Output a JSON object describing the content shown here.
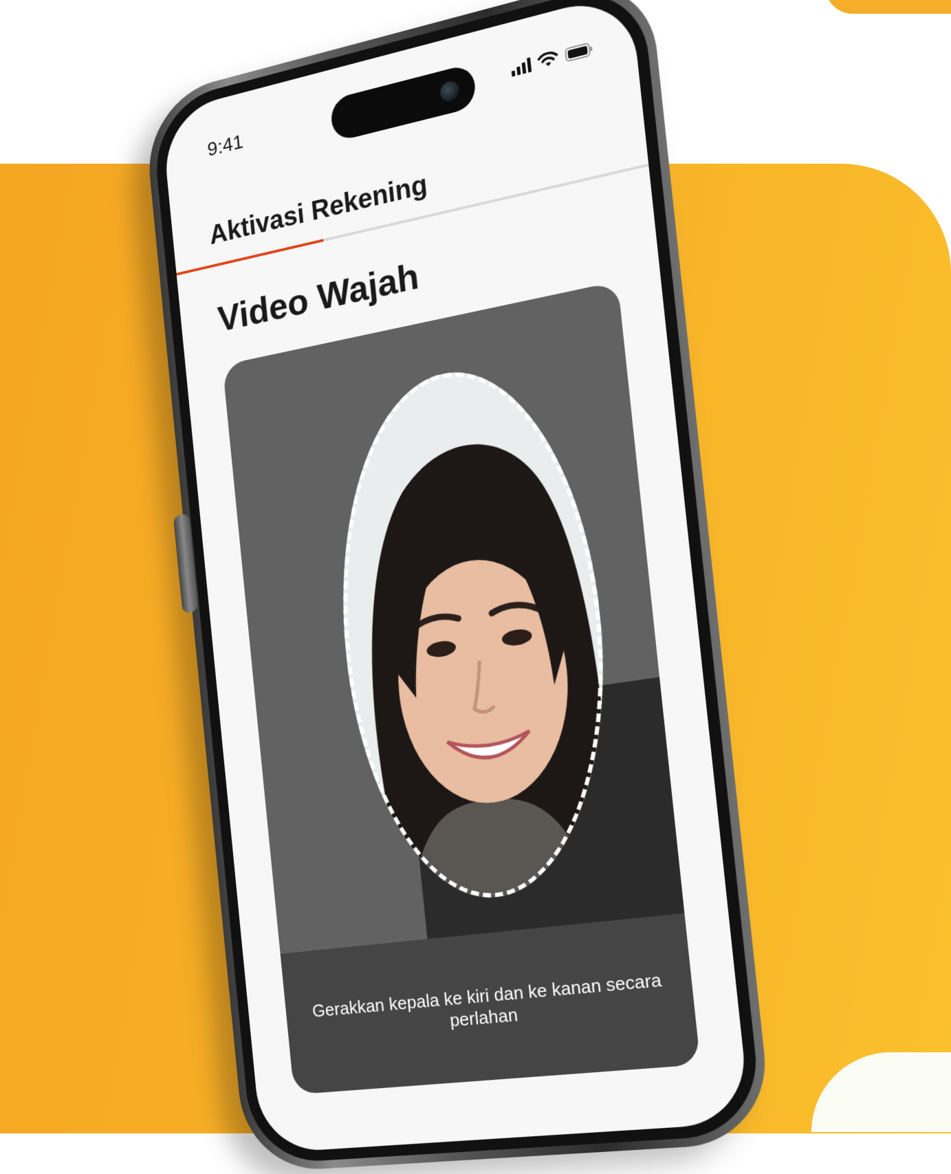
{
  "status_bar": {
    "time": "9:41",
    "icons": [
      "signal-icon",
      "wifi-icon",
      "battery-icon"
    ]
  },
  "header": {
    "title": "Aktivasi Rekening"
  },
  "progress": {
    "fraction": 0.33,
    "color": "#e2441c"
  },
  "page": {
    "section_title": "Video Wajah"
  },
  "camera": {
    "instruction": "Gerakkan kepala ke kiri dan ke kanan secara perlahan"
  },
  "colors": {
    "background_accent": "#f5a623",
    "progress_accent": "#e2441c"
  }
}
